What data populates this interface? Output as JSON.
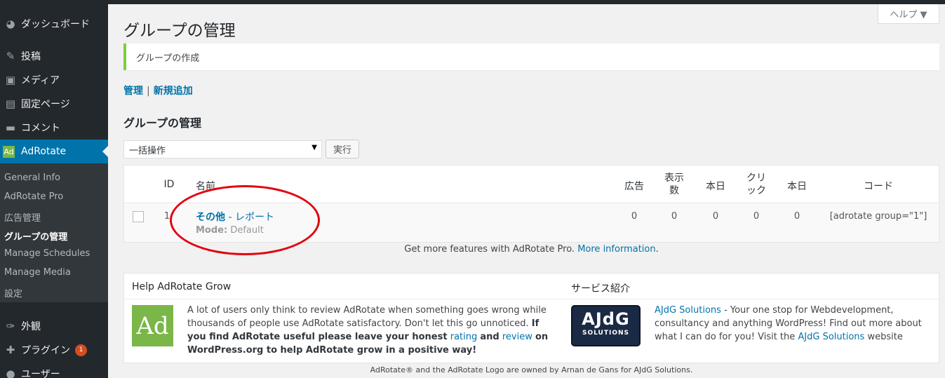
{
  "sidebar": {
    "items": [
      {
        "label": "ダッシュボード",
        "icon": "dashboard-icon"
      },
      {
        "label": "投稿",
        "icon": "pin-icon"
      },
      {
        "label": "メディア",
        "icon": "media-icon"
      },
      {
        "label": "固定ページ",
        "icon": "page-icon"
      },
      {
        "label": "コメント",
        "icon": "comment-icon"
      },
      {
        "label": "AdRotate",
        "icon": "adrotate-icon",
        "icon_text": "Ad"
      }
    ],
    "submenu": [
      "General Info",
      "AdRotate Pro",
      "広告管理",
      "グループの管理",
      "Manage Schedules",
      "Manage Media",
      "設定"
    ],
    "bottom_items": [
      {
        "label": "外観",
        "icon": "appearance-icon"
      },
      {
        "label": "プラグイン",
        "icon": "plugin-icon",
        "badge": "1"
      },
      {
        "label": "ユーザー",
        "icon": "user-icon"
      }
    ]
  },
  "help_tab": "ヘルプ ▼",
  "page_title": "グループの管理",
  "notice": "グループの作成",
  "subnav": {
    "manage": "管理",
    "separator": "|",
    "add_new": "新規追加"
  },
  "section_title": "グループの管理",
  "bulk_action": {
    "selected": "一括操作",
    "apply": "実行"
  },
  "table": {
    "headers": {
      "id": "ID",
      "name": "名前",
      "ads": "広告",
      "impressions": "表示数",
      "today1": "本日",
      "clicks": "クリック",
      "today2": "本日",
      "code": "コード"
    },
    "rows": [
      {
        "id": "1",
        "name": "その他",
        "report_link": "レポート",
        "mode_label": "Mode:",
        "mode_value": "Default",
        "ads": "0",
        "impressions": "0",
        "today1": "0",
        "clicks": "0",
        "today2": "0",
        "code": "[adrotate group=\"1\"]"
      }
    ]
  },
  "promo": {
    "text": "Get more features with AdRotate Pro.",
    "link": "More information",
    "end": "."
  },
  "help_panel": {
    "title": "Help AdRotate Grow",
    "logo": "Ad",
    "text_plain": "A lot of users only think to review AdRotate when something goes wrong while thousands of people use AdRotate satisfactory. Don't let this go unnoticed.",
    "text_bold_1": "If you find AdRotate useful please leave your honest",
    "link_rating": "rating",
    "and": "and",
    "link_review": "review",
    "text_bold_2": "on WordPress.org to help AdRotate grow in a positive way!"
  },
  "service_panel": {
    "title": "サービス紹介",
    "logo_big": "AJdG",
    "logo_small": "SOLUTIONS",
    "link1": "AJdG Solutions",
    "text1": "- Your one stop for Webdevelopment, consultancy and anything WordPress! Find out more about what I can do for you! Visit the",
    "link2": "AJdG Solutions",
    "text2": "website"
  },
  "footer": "AdRotate® and the AdRotate Logo are owned by Arnan de Gans for AJdG Solutions.",
  "colors": {
    "accent": "#0073aa",
    "sidebar": "#23282d",
    "notice_border": "#7ad03a",
    "annotation": "#e3000f",
    "logo_green": "#7ab648"
  }
}
